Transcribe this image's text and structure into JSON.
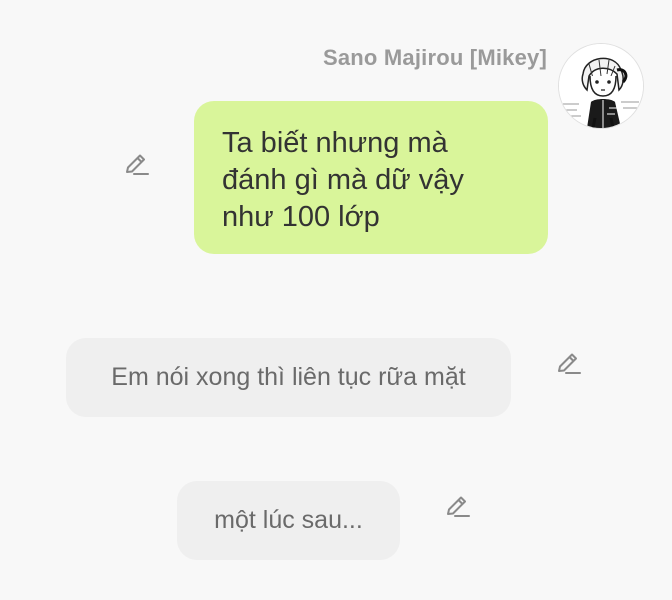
{
  "chat": {
    "sender": {
      "name": "Sano Majirou [Mikey]",
      "avatar_icon": "character-portrait-avatar"
    },
    "messages": [
      {
        "type": "dialogue",
        "lines": [
          "Ta biết nhưng mà",
          "đánh gì mà dữ vậy",
          "như 100 lớp"
        ],
        "bubble_color": "#d9f59a",
        "action_icon": "edit-pencil-icon"
      },
      {
        "type": "narration",
        "text": "Em nói xong thì liên tục rữa mặt",
        "bubble_color": "#efefef",
        "action_icon": "edit-pencil-icon"
      },
      {
        "type": "narration",
        "text": "một lúc sau...",
        "bubble_color": "#efefef",
        "action_icon": "edit-pencil-icon"
      }
    ]
  },
  "colors": {
    "background": "#f8f8f8",
    "name_text": "#9a9a9a",
    "icon": "#8a8a8a"
  }
}
